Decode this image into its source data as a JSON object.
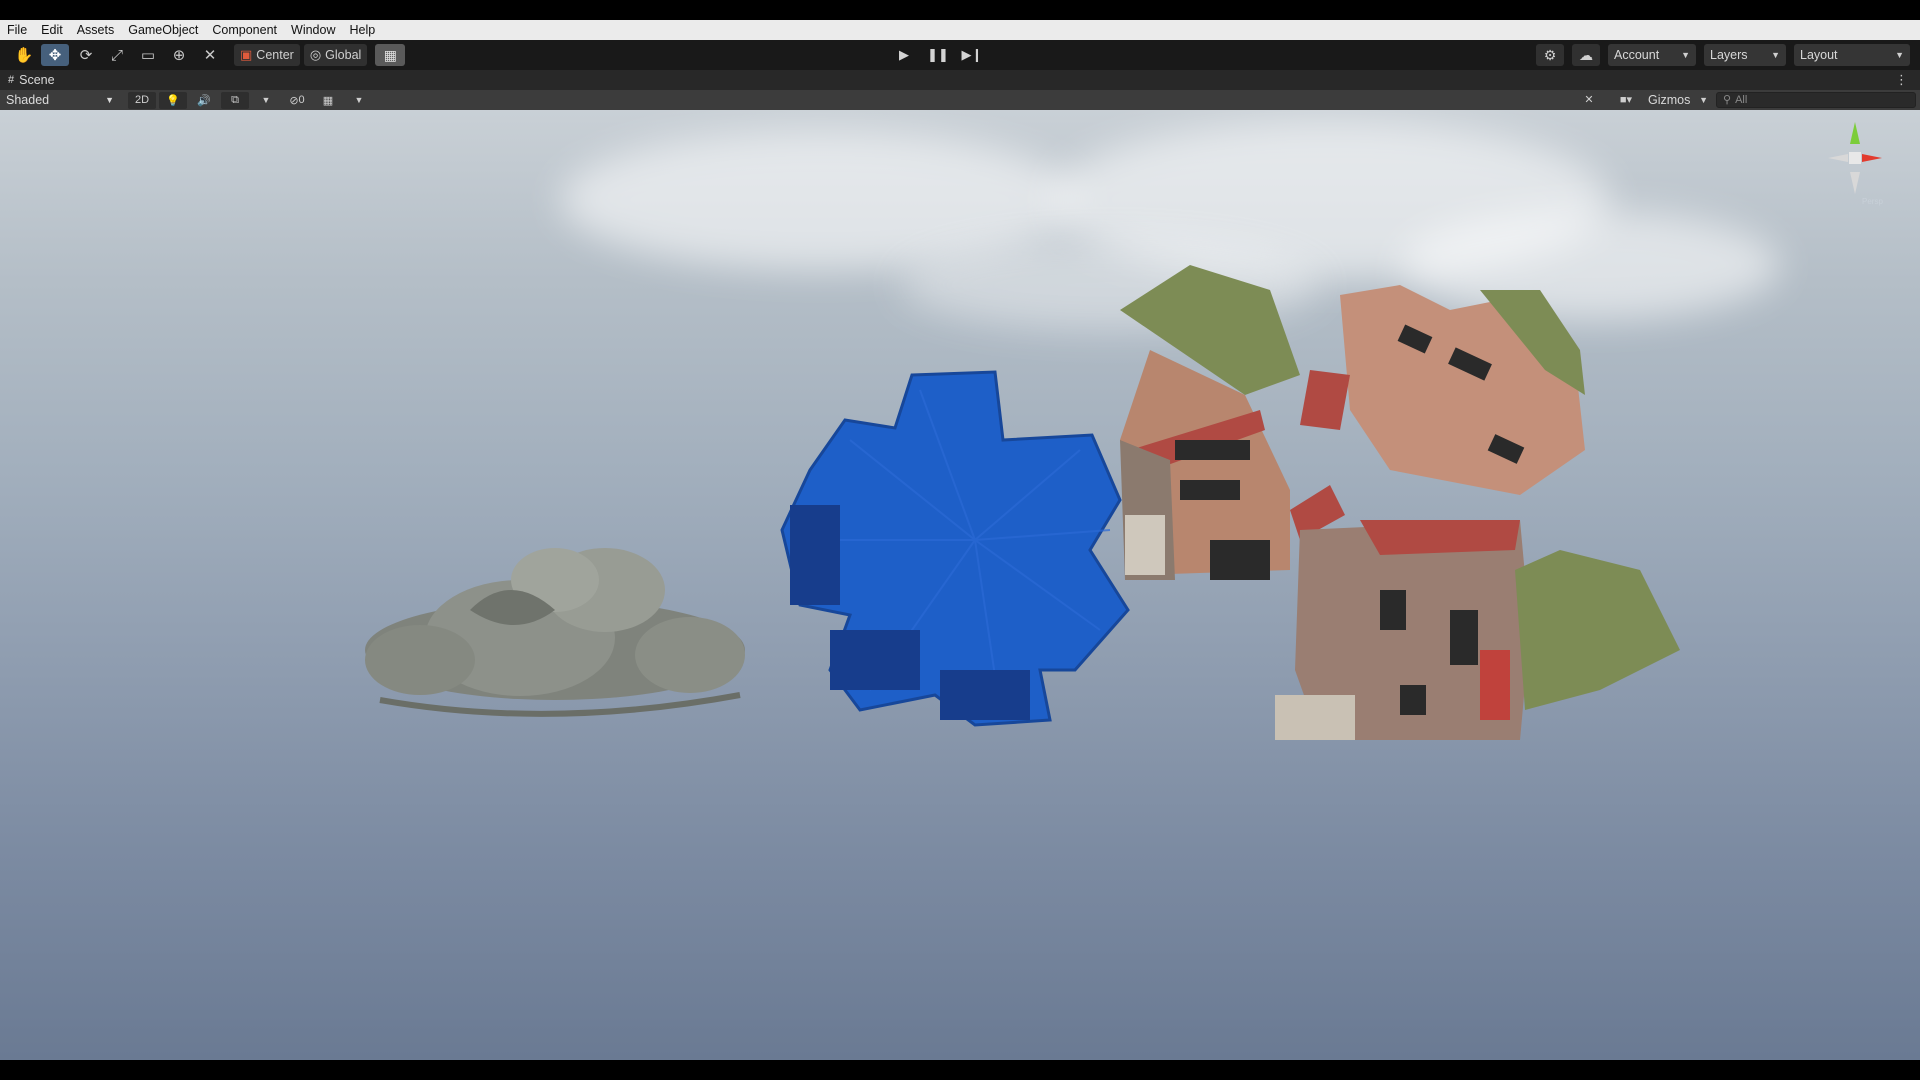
{
  "menu": [
    "File",
    "Edit",
    "Assets",
    "GameObject",
    "Component",
    "Window",
    "Help"
  ],
  "toolbar": {
    "tools": [
      {
        "name": "hand-tool",
        "glyph": "✋"
      },
      {
        "name": "move-tool",
        "glyph": "✥"
      },
      {
        "name": "rotate-tool",
        "glyph": "⟳"
      },
      {
        "name": "scale-tool",
        "glyph": "⤢"
      },
      {
        "name": "rect-tool",
        "glyph": "▭"
      },
      {
        "name": "transform-tool",
        "glyph": "⊕"
      },
      {
        "name": "custom-tool",
        "glyph": "✕"
      }
    ],
    "pivot_label": "Center",
    "space_label": "Global",
    "account_label": "Account",
    "layers_label": "Layers",
    "layout_label": "Layout"
  },
  "scene": {
    "tab_label": "Scene",
    "shading_mode": "Shaded",
    "mode_2d": "2D",
    "hidden_count": "0",
    "gizmos_label": "Gizmos",
    "search_placeholder": "All",
    "persp_label": "Persp"
  },
  "colors": {
    "container_blue": "#1e5fc8",
    "statue_grey": "#8c8f88",
    "roof_green": "#7d8c55",
    "wall_brick": "#b8866e",
    "accent_active": "#46607c"
  }
}
